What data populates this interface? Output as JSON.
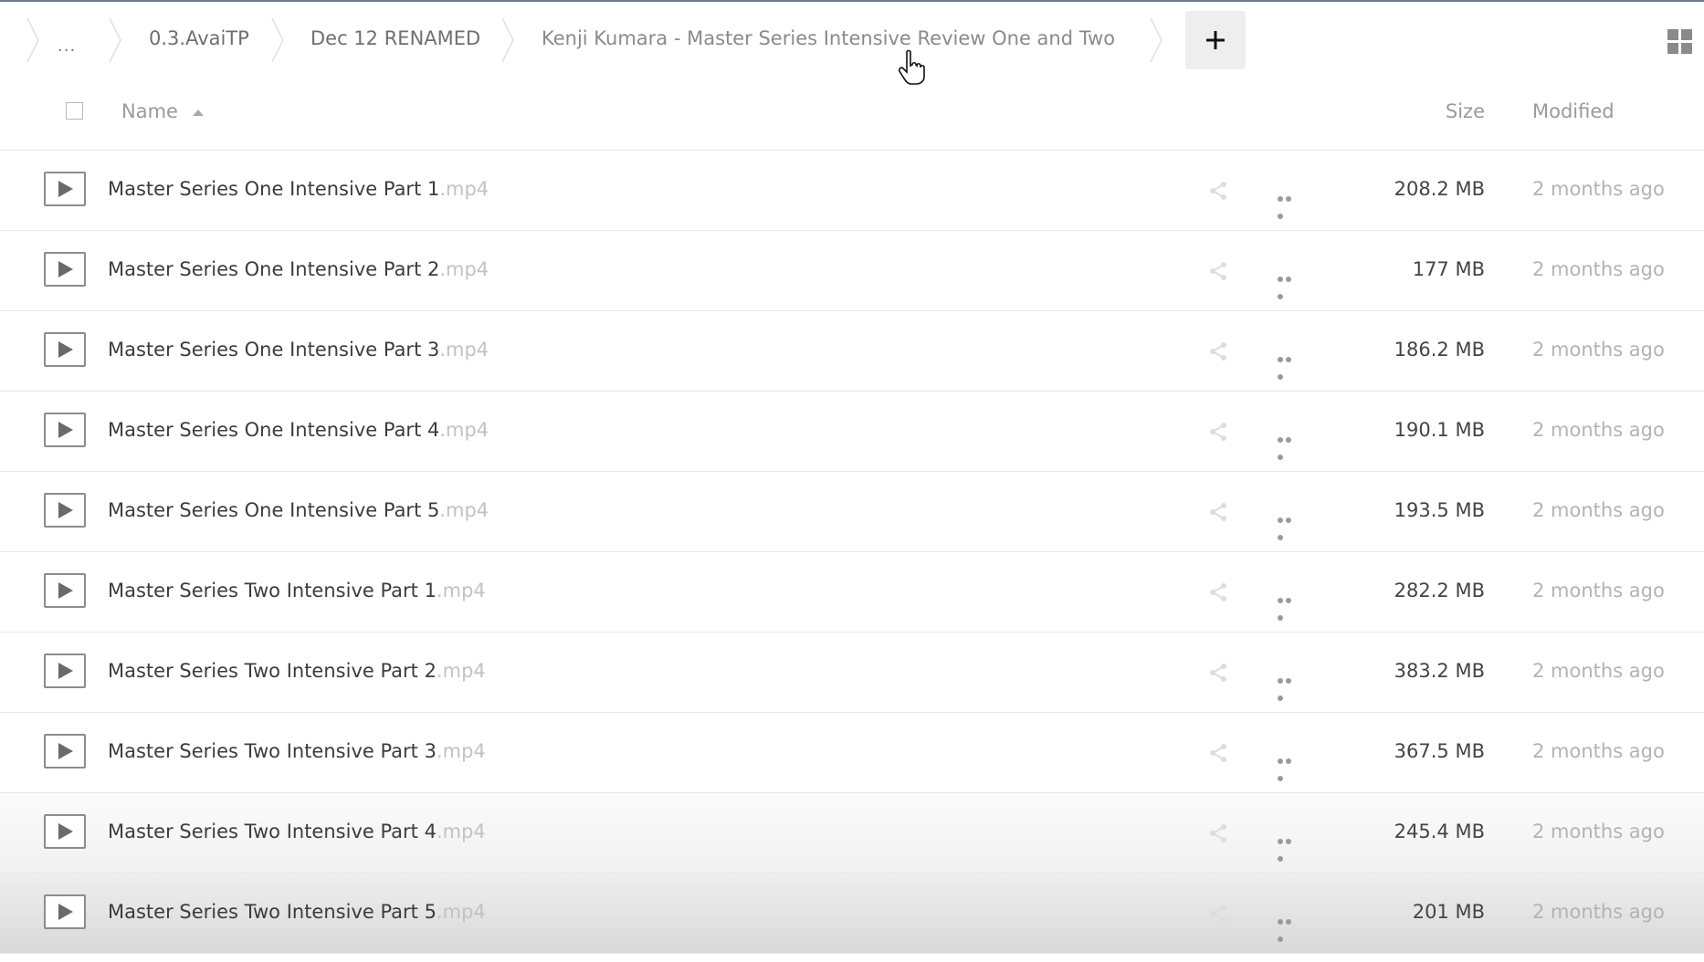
{
  "breadcrumbs": [
    {
      "label": "..."
    },
    {
      "label": "0.3.AvaiTP"
    },
    {
      "label": "Dec 12 RENAMED"
    },
    {
      "label": "Kenji Kumara - Master Series Intensive Review One and Two"
    }
  ],
  "toolbar": {
    "add_symbol": "+"
  },
  "header": {
    "name": "Name",
    "size": "Size",
    "modified": "Modified"
  },
  "files": [
    {
      "name": "Master Series One Intensive Part 1",
      "ext": ".mp4",
      "size": "208.2 MB",
      "modified": "2 months ago"
    },
    {
      "name": "Master Series One Intensive Part 2",
      "ext": ".mp4",
      "size": "177 MB",
      "modified": "2 months ago"
    },
    {
      "name": "Master Series One Intensive Part 3",
      "ext": ".mp4",
      "size": "186.2 MB",
      "modified": "2 months ago"
    },
    {
      "name": "Master Series One Intensive Part 4",
      "ext": ".mp4",
      "size": "190.1 MB",
      "modified": "2 months ago"
    },
    {
      "name": "Master Series One Intensive Part 5",
      "ext": ".mp4",
      "size": "193.5 MB",
      "modified": "2 months ago"
    },
    {
      "name": "Master Series Two Intensive Part 1",
      "ext": ".mp4",
      "size": "282.2 MB",
      "modified": "2 months ago"
    },
    {
      "name": "Master Series Two Intensive Part 2",
      "ext": ".mp4",
      "size": "383.2 MB",
      "modified": "2 months ago"
    },
    {
      "name": "Master Series Two Intensive Part 3",
      "ext": ".mp4",
      "size": "367.5 MB",
      "modified": "2 months ago"
    },
    {
      "name": "Master Series Two Intensive Part 4",
      "ext": ".mp4",
      "size": "245.4 MB",
      "modified": "2 months ago"
    },
    {
      "name": "Master Series Two Intensive Part 5",
      "ext": ".mp4",
      "size": "201 MB",
      "modified": "2 months ago"
    }
  ],
  "icons": {
    "file": "video-file-icon",
    "share": "share-icon",
    "more": "more-options-icon",
    "add": "plus-icon",
    "view": "grid-view-icon",
    "sort": "sort-ascending-icon"
  },
  "colors": {
    "text": "#3c3c3c",
    "muted": "#9a9a9a",
    "extension": "#c2c2c2",
    "divider": "#e6e6e6"
  }
}
